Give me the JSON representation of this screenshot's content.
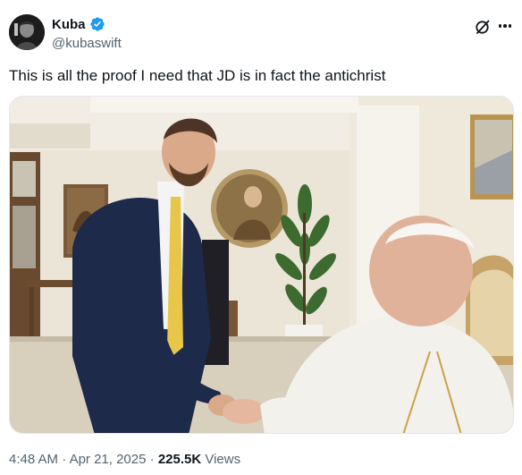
{
  "author": {
    "display_name": "Kuba",
    "handle": "@kubaswift",
    "verified": true,
    "verified_color": "#1d9bf0"
  },
  "icons": {
    "grok": "grok-slash-icon",
    "more": "more-horizontal-icon",
    "verified": "verified-badge-icon"
  },
  "tweet": {
    "text": "This is all the proof I need that JD is in fact the antichrist",
    "time": "4:48 AM",
    "separator": "·",
    "date": "Apr 21, 2025",
    "views_count": "225.5K",
    "views_label": "Views"
  },
  "colors": {
    "text": "#0f1419",
    "secondary": "#536471"
  }
}
